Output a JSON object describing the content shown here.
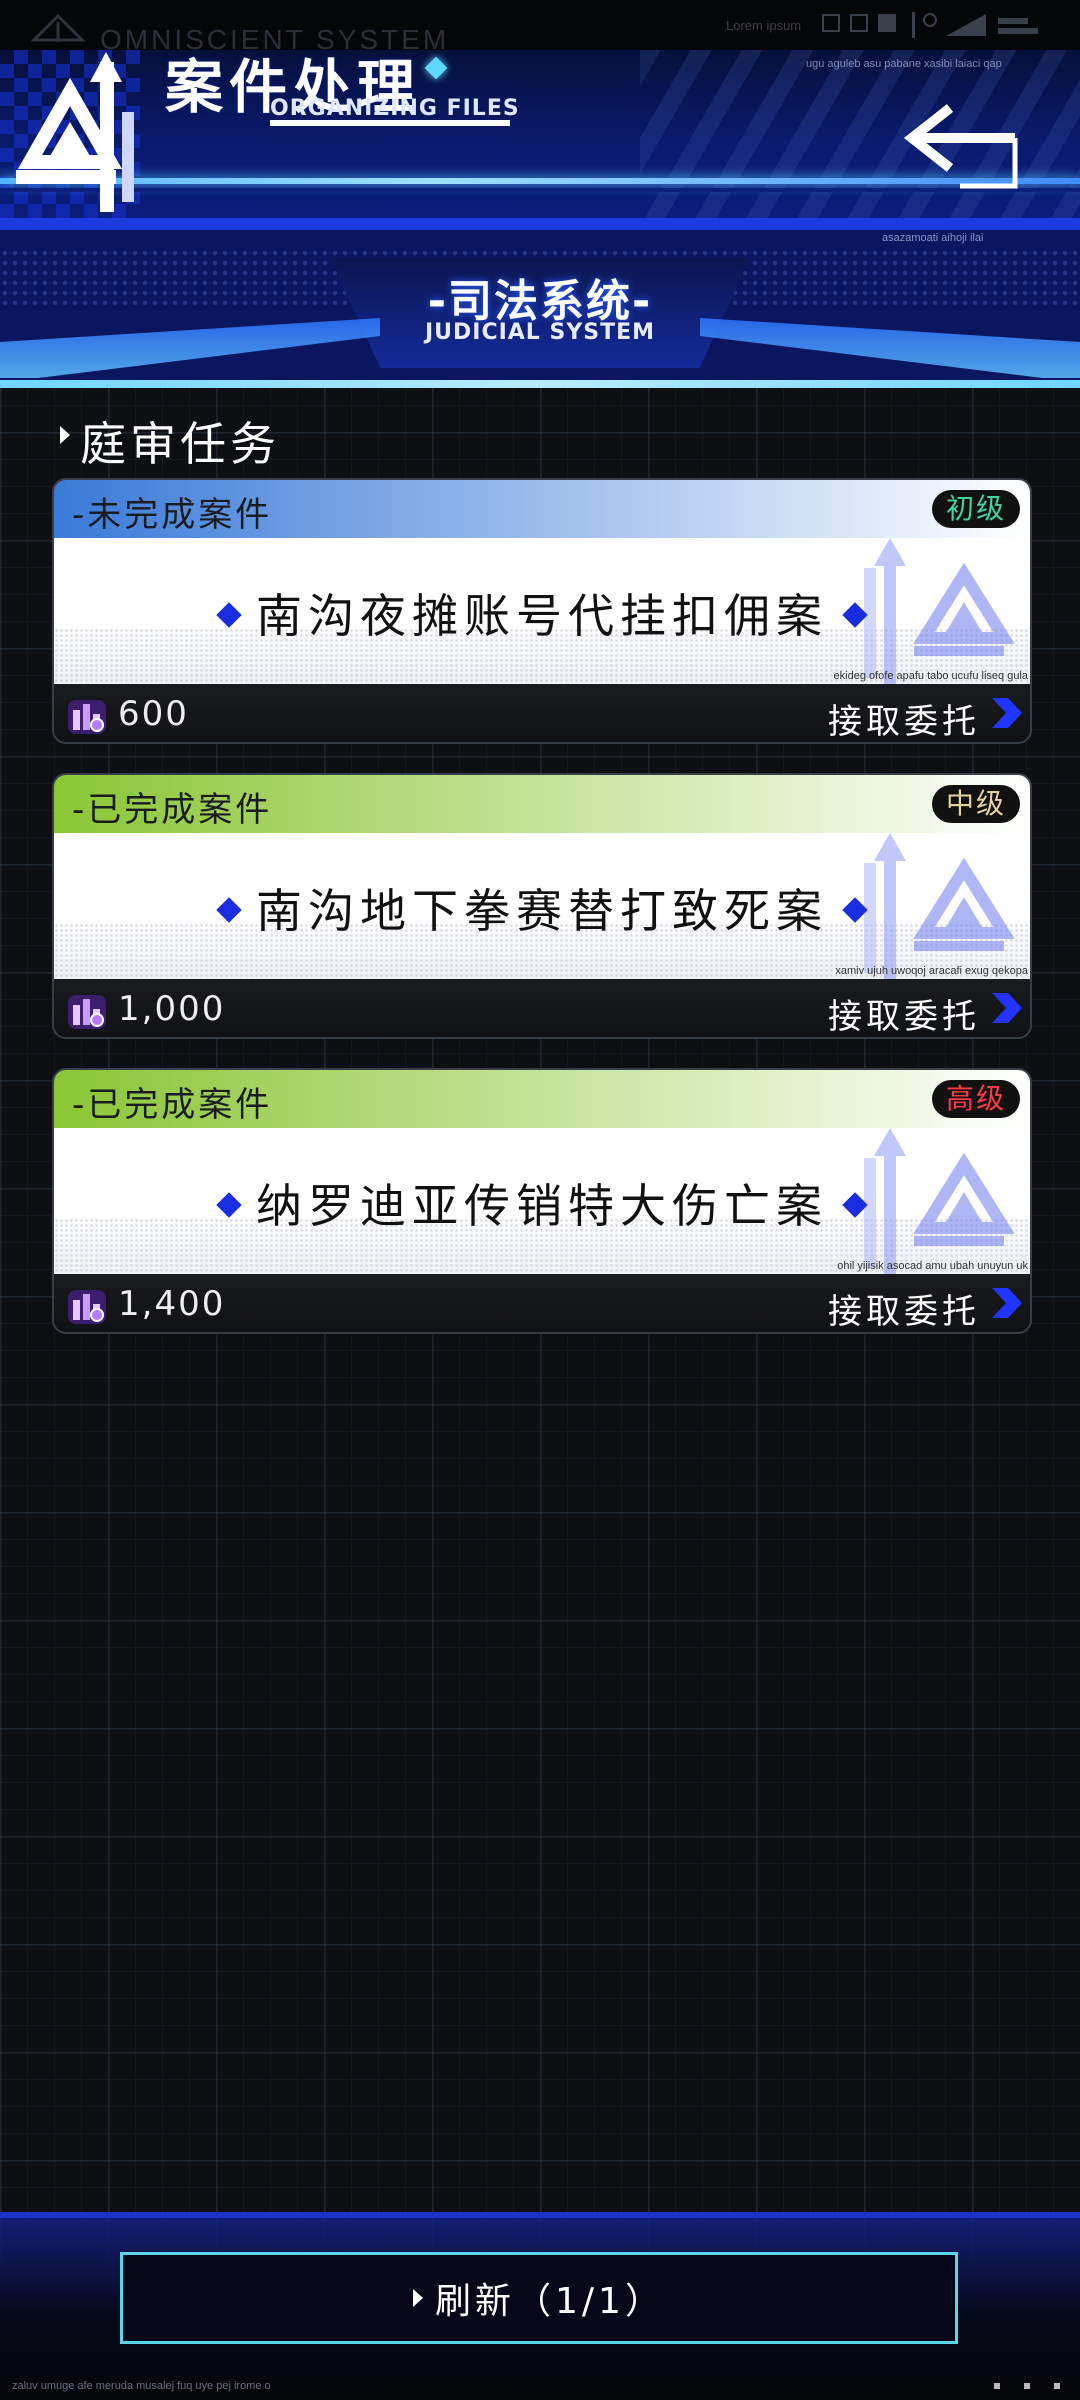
{
  "status_bar": {
    "system_name": "OMNISCIENT SYSTEM",
    "lorem": "Lorem ipsum"
  },
  "header": {
    "title": "案件处理",
    "subtitle": "ORGANIZING FILES",
    "tiny_text": "ugu aguleb asu pabane xasibi laiaci qap"
  },
  "system_banner": {
    "title": "-司法系统-",
    "subtitle": "JUDICIAL SYSTEM",
    "tiny_text": "asazamoati aihoji ilai"
  },
  "section": {
    "title": "庭审任务"
  },
  "cases": [
    {
      "status": "-未完成案件",
      "level": "初级",
      "level_color": "#3fd3a6",
      "head_gradient": [
        "#3a7ad8",
        "#ffffff"
      ],
      "name": "南沟夜摊账号代挂扣佣案",
      "tiny": "ekideg ofofe apafu tabo ucufu liseq gula",
      "reward": "600",
      "action": "接取委托"
    },
    {
      "status": "-已完成案件",
      "level": "中级",
      "level_color": "#e6d3a3",
      "head_gradient": [
        "#8ac634",
        "#ffffff"
      ],
      "name": "南沟地下拳赛替打致死案",
      "tiny": "xamiv ujuh uwoqoj aracafi exug qekopa",
      "reward": "1,000",
      "action": "接取委托"
    },
    {
      "status": "-已完成案件",
      "level": "高级",
      "level_color": "#ff3b47",
      "head_gradient": [
        "#8ac634",
        "#ffffff"
      ],
      "name": "纳罗迪亚传销特大伤亡案",
      "tiny": "ohil yijisik asocad amu ubah unuyun uk",
      "reward": "1,400",
      "action": "接取委托"
    }
  ],
  "refresh": {
    "label": "刷新（1/1）"
  },
  "footer": {
    "tiny_text": "zaluv umuge afe meruda musalej fuq uye pej irome o"
  },
  "colors": {
    "accent_blue": "#1b2de0",
    "cyan_border": "#5ad6e8"
  }
}
